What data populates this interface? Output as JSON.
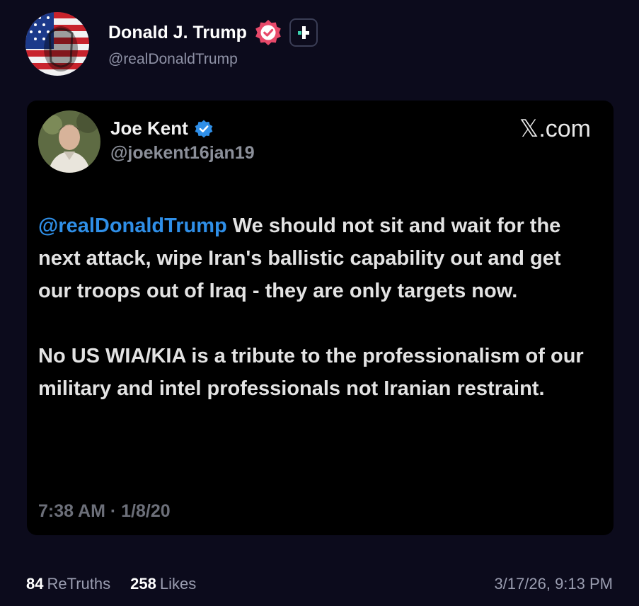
{
  "post": {
    "author_name": "Donald J. Trump",
    "author_handle": "@realDonaldTrump",
    "verified_badge_icon": "verified-badge-icon",
    "plus_badge_icon": "plus-icon",
    "accent_color": "#e8496a"
  },
  "embed": {
    "author_name": "Joe Kent",
    "author_handle": "@joekent16jan19",
    "source_label": "𝕏.com",
    "mention": "@realDonaldTrump",
    "paragraph_1": " We should not sit and wait for the next attack, wipe Iran's ballistic capability out and get our troops out of Iraq - they are only targets now.",
    "paragraph_2": "No US WIA/KIA is a tribute to the professionalism of our military and intel professionals not Iranian restraint.",
    "timestamp": "7:38 AM · 1/8/20",
    "mention_color": "#2f8fe8"
  },
  "footer": {
    "retruths_count": "84",
    "retruths_label": "ReTruths",
    "likes_count": "258",
    "likes_label": "Likes",
    "date": "3/17/26, 9:13 PM"
  }
}
